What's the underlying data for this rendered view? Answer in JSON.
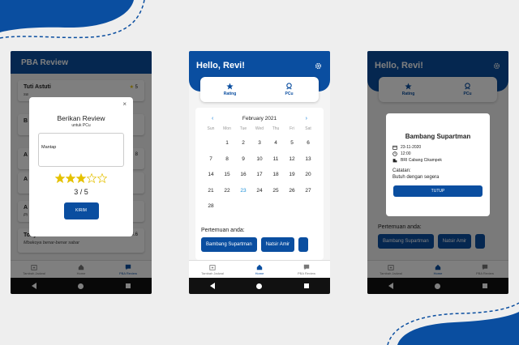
{
  "screen1": {
    "header_title": "PBA Review",
    "reviews": [
      {
        "name": "Tuti Astuti",
        "text": "sa",
        "score": "5"
      },
      {
        "name": "B",
        "text": "",
        "score": ""
      },
      {
        "name": "A",
        "text": "",
        "score": "8"
      },
      {
        "name": "A",
        "text": "",
        "score": ""
      },
      {
        "name": "A",
        "text": "Pi",
        "score": ""
      },
      {
        "name": "Tony",
        "text": "Mbakoya benar-benar sabar",
        "score": "4.6"
      }
    ],
    "modal": {
      "title": "Berikan Review",
      "subtitle": "untuk PCu",
      "review_text": "Mantap",
      "rating": 3,
      "rating_max": 5,
      "rating_text": "3 / 5",
      "submit_label": "KIRIM",
      "close_glyph": "×"
    },
    "tabs": [
      "Tambah Jadwal",
      "Home",
      "PBA Review"
    ]
  },
  "screen2": {
    "greeting": "Hello, Revi!",
    "tab_rating": "Rating",
    "tab_pcu": "PCu",
    "calendar": {
      "month_label": "February 2021",
      "weekdays": [
        "Sun",
        "Mon",
        "Tue",
        "Wed",
        "Thu",
        "Fri",
        "Sat"
      ],
      "days": [
        "",
        "1",
        "2",
        "3",
        "4",
        "5",
        "6",
        "7",
        "8",
        "9",
        "10",
        "11",
        "12",
        "13",
        "14",
        "15",
        "16",
        "17",
        "18",
        "19",
        "20",
        "21",
        "22",
        "23",
        "24",
        "25",
        "26",
        "27",
        "28"
      ],
      "highlighted_day": "23",
      "prev_glyph": "‹",
      "next_glyph": "›"
    },
    "meetings_label": "Pertemuan anda:",
    "meetings": [
      "Bambang Supartman",
      "Natsir Amir",
      ""
    ],
    "tabs": [
      "Tambah Jadwal",
      "Home",
      "PBA Review"
    ]
  },
  "screen3": {
    "greeting": "Hello, Revi!",
    "tab_rating": "Rating",
    "tab_pcu": "PCu",
    "modal": {
      "name": "Bambang Supartman",
      "date": "23-11-2020",
      "time": "12:00",
      "location": "BRI Cabang Cikampek",
      "notes_label": "Catatan:",
      "notes": "Butuh dengan segera",
      "close_label": "TUTUP"
    },
    "meetings_label": "Pertemuan anda:",
    "meetings": [
      "Bambang Supartman",
      "Natsir Amir",
      ""
    ],
    "tabs": [
      "Tambah Jadwal",
      "Home",
      "PBA Review"
    ]
  },
  "colors": {
    "primary": "#0a4ea0",
    "star": "#e5c100",
    "highlight": "#1a8fd8"
  }
}
